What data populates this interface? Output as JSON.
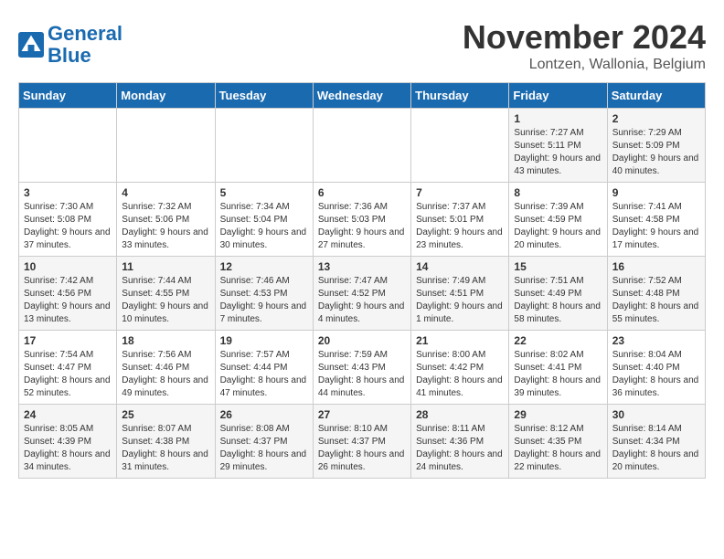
{
  "header": {
    "logo_line1": "General",
    "logo_line2": "Blue",
    "month_title": "November 2024",
    "location": "Lontzen, Wallonia, Belgium"
  },
  "days_of_week": [
    "Sunday",
    "Monday",
    "Tuesday",
    "Wednesday",
    "Thursday",
    "Friday",
    "Saturday"
  ],
  "weeks": [
    [
      {
        "day": "",
        "info": ""
      },
      {
        "day": "",
        "info": ""
      },
      {
        "day": "",
        "info": ""
      },
      {
        "day": "",
        "info": ""
      },
      {
        "day": "",
        "info": ""
      },
      {
        "day": "1",
        "info": "Sunrise: 7:27 AM\nSunset: 5:11 PM\nDaylight: 9 hours and 43 minutes."
      },
      {
        "day": "2",
        "info": "Sunrise: 7:29 AM\nSunset: 5:09 PM\nDaylight: 9 hours and 40 minutes."
      }
    ],
    [
      {
        "day": "3",
        "info": "Sunrise: 7:30 AM\nSunset: 5:08 PM\nDaylight: 9 hours and 37 minutes."
      },
      {
        "day": "4",
        "info": "Sunrise: 7:32 AM\nSunset: 5:06 PM\nDaylight: 9 hours and 33 minutes."
      },
      {
        "day": "5",
        "info": "Sunrise: 7:34 AM\nSunset: 5:04 PM\nDaylight: 9 hours and 30 minutes."
      },
      {
        "day": "6",
        "info": "Sunrise: 7:36 AM\nSunset: 5:03 PM\nDaylight: 9 hours and 27 minutes."
      },
      {
        "day": "7",
        "info": "Sunrise: 7:37 AM\nSunset: 5:01 PM\nDaylight: 9 hours and 23 minutes."
      },
      {
        "day": "8",
        "info": "Sunrise: 7:39 AM\nSunset: 4:59 PM\nDaylight: 9 hours and 20 minutes."
      },
      {
        "day": "9",
        "info": "Sunrise: 7:41 AM\nSunset: 4:58 PM\nDaylight: 9 hours and 17 minutes."
      }
    ],
    [
      {
        "day": "10",
        "info": "Sunrise: 7:42 AM\nSunset: 4:56 PM\nDaylight: 9 hours and 13 minutes."
      },
      {
        "day": "11",
        "info": "Sunrise: 7:44 AM\nSunset: 4:55 PM\nDaylight: 9 hours and 10 minutes."
      },
      {
        "day": "12",
        "info": "Sunrise: 7:46 AM\nSunset: 4:53 PM\nDaylight: 9 hours and 7 minutes."
      },
      {
        "day": "13",
        "info": "Sunrise: 7:47 AM\nSunset: 4:52 PM\nDaylight: 9 hours and 4 minutes."
      },
      {
        "day": "14",
        "info": "Sunrise: 7:49 AM\nSunset: 4:51 PM\nDaylight: 9 hours and 1 minute."
      },
      {
        "day": "15",
        "info": "Sunrise: 7:51 AM\nSunset: 4:49 PM\nDaylight: 8 hours and 58 minutes."
      },
      {
        "day": "16",
        "info": "Sunrise: 7:52 AM\nSunset: 4:48 PM\nDaylight: 8 hours and 55 minutes."
      }
    ],
    [
      {
        "day": "17",
        "info": "Sunrise: 7:54 AM\nSunset: 4:47 PM\nDaylight: 8 hours and 52 minutes."
      },
      {
        "day": "18",
        "info": "Sunrise: 7:56 AM\nSunset: 4:46 PM\nDaylight: 8 hours and 49 minutes."
      },
      {
        "day": "19",
        "info": "Sunrise: 7:57 AM\nSunset: 4:44 PM\nDaylight: 8 hours and 47 minutes."
      },
      {
        "day": "20",
        "info": "Sunrise: 7:59 AM\nSunset: 4:43 PM\nDaylight: 8 hours and 44 minutes."
      },
      {
        "day": "21",
        "info": "Sunrise: 8:00 AM\nSunset: 4:42 PM\nDaylight: 8 hours and 41 minutes."
      },
      {
        "day": "22",
        "info": "Sunrise: 8:02 AM\nSunset: 4:41 PM\nDaylight: 8 hours and 39 minutes."
      },
      {
        "day": "23",
        "info": "Sunrise: 8:04 AM\nSunset: 4:40 PM\nDaylight: 8 hours and 36 minutes."
      }
    ],
    [
      {
        "day": "24",
        "info": "Sunrise: 8:05 AM\nSunset: 4:39 PM\nDaylight: 8 hours and 34 minutes."
      },
      {
        "day": "25",
        "info": "Sunrise: 8:07 AM\nSunset: 4:38 PM\nDaylight: 8 hours and 31 minutes."
      },
      {
        "day": "26",
        "info": "Sunrise: 8:08 AM\nSunset: 4:37 PM\nDaylight: 8 hours and 29 minutes."
      },
      {
        "day": "27",
        "info": "Sunrise: 8:10 AM\nSunset: 4:37 PM\nDaylight: 8 hours and 26 minutes."
      },
      {
        "day": "28",
        "info": "Sunrise: 8:11 AM\nSunset: 4:36 PM\nDaylight: 8 hours and 24 minutes."
      },
      {
        "day": "29",
        "info": "Sunrise: 8:12 AM\nSunset: 4:35 PM\nDaylight: 8 hours and 22 minutes."
      },
      {
        "day": "30",
        "info": "Sunrise: 8:14 AM\nSunset: 4:34 PM\nDaylight: 8 hours and 20 minutes."
      }
    ]
  ]
}
